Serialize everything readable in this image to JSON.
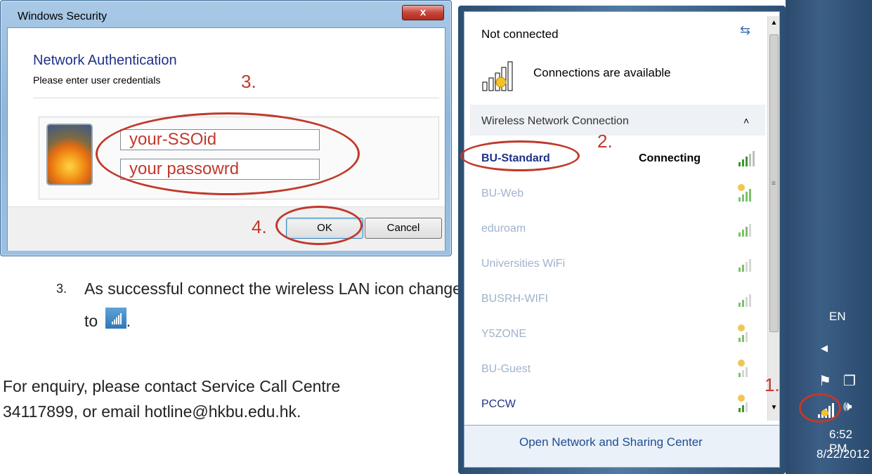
{
  "security_dialog": {
    "title": "Windows Security",
    "close_label": "x",
    "heading": "Network Authentication",
    "subheading": "Please enter user credentials",
    "username_value": "your-SSOid",
    "password_value": "your passowrd",
    "ok_label": "OK",
    "cancel_label": "Cancel"
  },
  "annotations": {
    "step1": "1.",
    "step2": "2.",
    "step3": "3.",
    "step4": "4."
  },
  "instructions": {
    "step_number": "3.",
    "step_text": "As successful connect the wireless LAN icon change to",
    "enquiry_line1": "For enquiry, please contact Service Call Centre",
    "enquiry_line2": "34117899, or email hotline@hkbu.edu.hk."
  },
  "network_flyout": {
    "status": "Not connected",
    "availability": "Connections are available",
    "section_header": "Wireless Network Connection",
    "networks": [
      {
        "name": "BU-Standard",
        "status": "Connecting"
      },
      {
        "name": "BU-Web",
        "status": ""
      },
      {
        "name": "eduroam",
        "status": ""
      },
      {
        "name": "Universities WiFi",
        "status": ""
      },
      {
        "name": "BUSRH-WIFI",
        "status": ""
      },
      {
        "name": "Y5ZONE",
        "status": ""
      },
      {
        "name": "BU-Guest",
        "status": ""
      },
      {
        "name": "PCCW",
        "status": ""
      }
    ],
    "footer_link": "Open Network and Sharing Center"
  },
  "taskbar": {
    "language": "EN",
    "time": "6:52 PM",
    "date": "8/22/2012"
  },
  "colors": {
    "annotation_red": "#c0392b",
    "link_blue": "#1e4d94",
    "heading_blue": "#1e3287",
    "taskbar_blue": "#3c5f86"
  },
  "icons": {
    "refresh": "refresh-icon",
    "wifi_signal": "wifi-signal-icon",
    "speaker": "speaker-icon",
    "flag": "action-center-flag-icon"
  }
}
